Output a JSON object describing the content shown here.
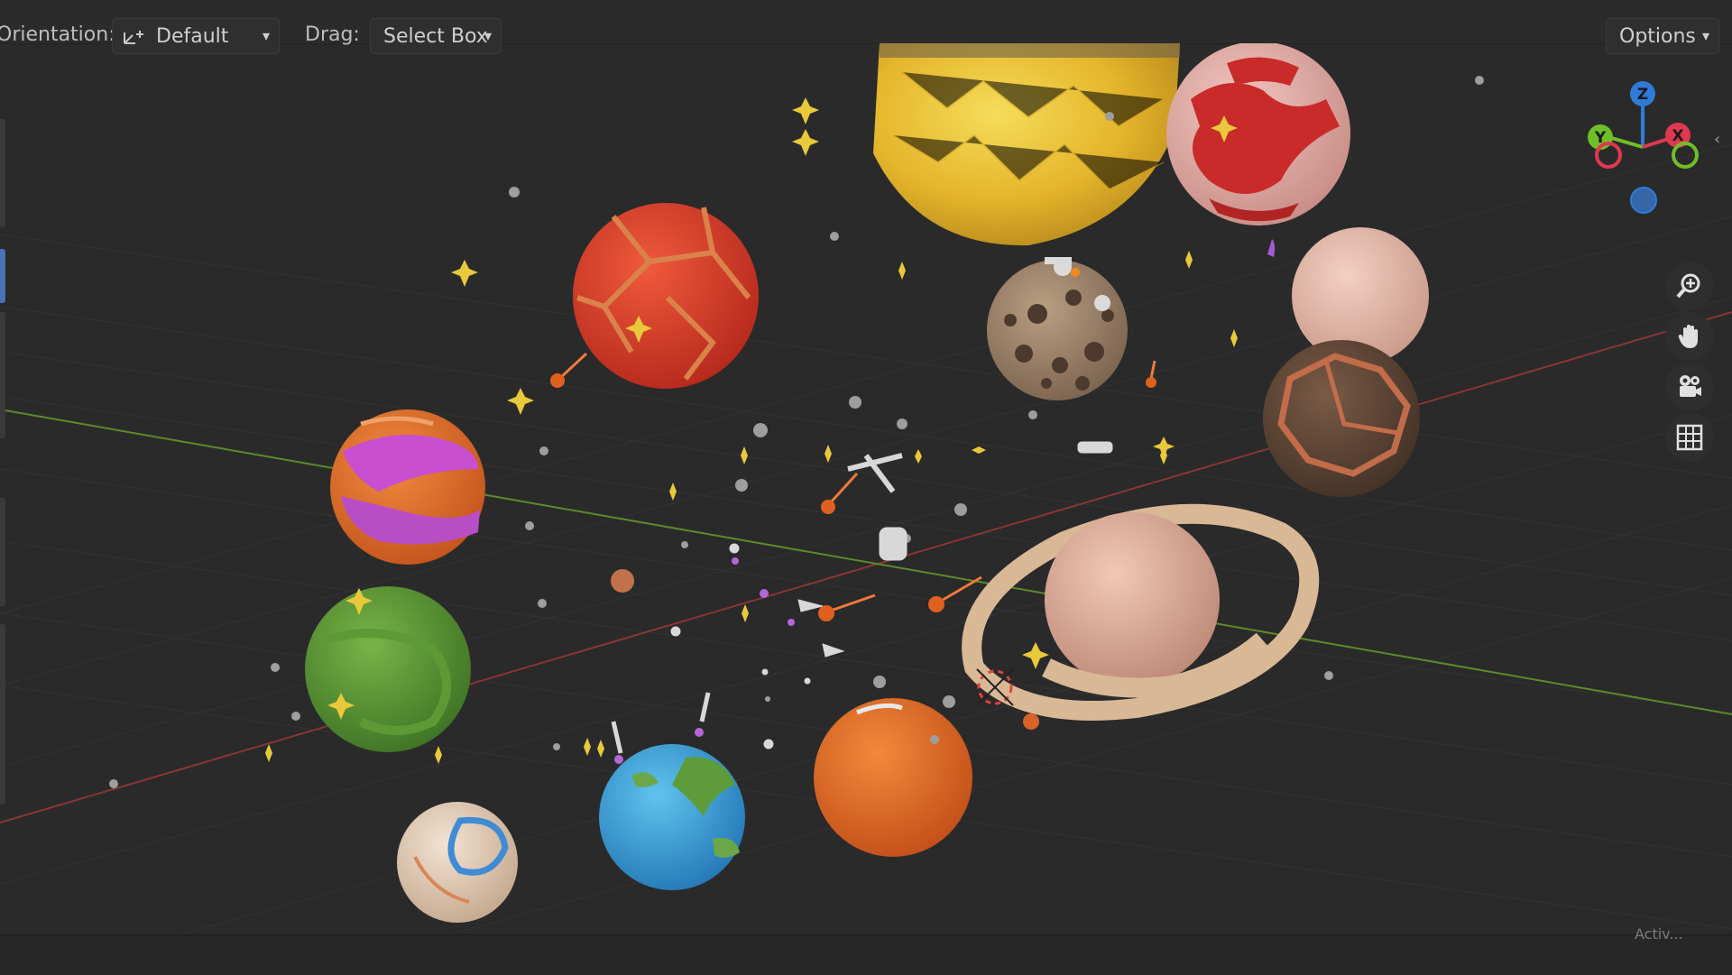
{
  "header": {
    "orientation_label": "Orientation:",
    "orientation_value": "Default",
    "drag_label": "Drag:",
    "drag_value": "Select Box",
    "options_label": "Options"
  },
  "gizmo": {
    "z_label": "Z",
    "y_label": "Y",
    "x_label": "X",
    "z_color": "#2f7bd8",
    "y_color": "#6fbf2a",
    "x_color": "#e0394f"
  },
  "nav_tools": [
    "zoom-icon",
    "hand-pan-icon",
    "camera-icon",
    "grid-ortho-icon"
  ],
  "status": {
    "bottom_hint": "Activ..."
  },
  "scene": {
    "floor_axis_x_color": "#8a3535",
    "floor_axis_y_color": "#5d8a2a",
    "objects": [
      "sun",
      "red-cracked-planet",
      "rocky-moon",
      "red-marble-planet",
      "pink-planet",
      "brown-cracked-planet",
      "orange-purple-planet",
      "green-planet",
      "ringed-planet",
      "orange-planet",
      "earth",
      "cream-planet"
    ]
  }
}
